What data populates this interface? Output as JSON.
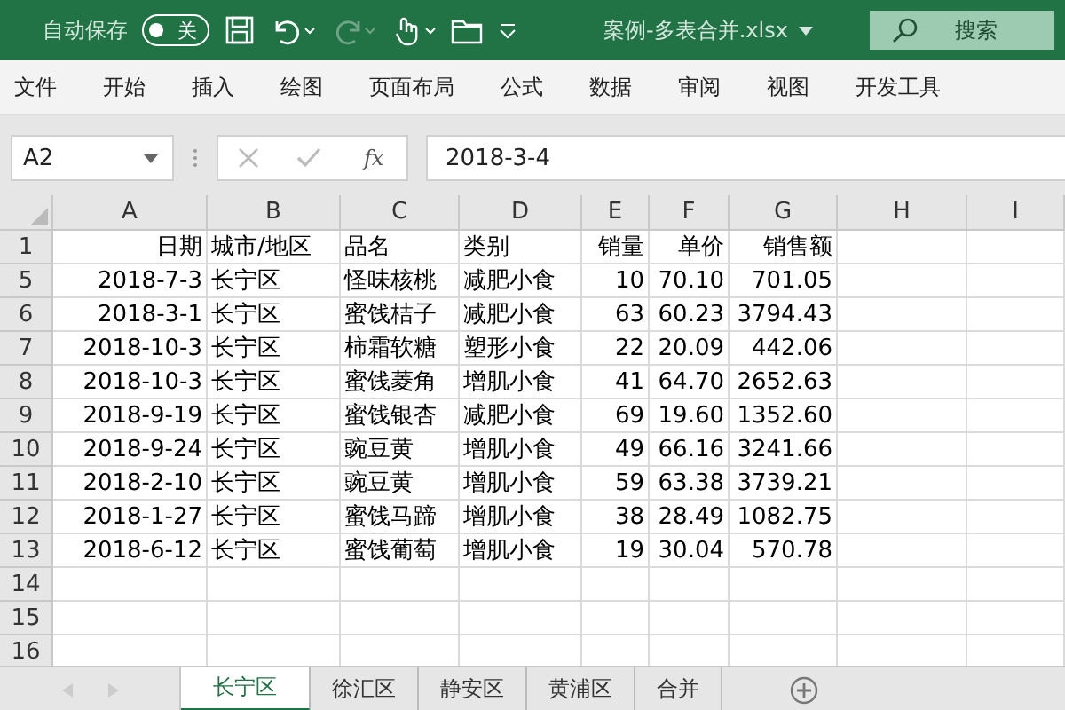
{
  "title_bar": {
    "autosave_label": "自动保存",
    "autosave": {
      "on": false,
      "state_label": "关"
    },
    "redo_disabled": true,
    "filename": "案例-多表合并.xlsx",
    "search_placeholder": "搜索"
  },
  "ribbon_tabs": [
    {
      "label": "文件",
      "selected": false
    },
    {
      "label": "开始",
      "selected": false
    },
    {
      "label": "插入",
      "selected": false
    },
    {
      "label": "绘图",
      "selected": false
    },
    {
      "label": "页面布局",
      "selected": false
    },
    {
      "label": "公式",
      "selected": false
    },
    {
      "label": "数据",
      "selected": false
    },
    {
      "label": "审阅",
      "selected": false
    },
    {
      "label": "视图",
      "selected": false
    },
    {
      "label": "开发工具",
      "selected": false
    }
  ],
  "formula_bar": {
    "name_box": "A2",
    "fx": "fx",
    "value": "2018-3-4"
  },
  "sheet": {
    "columns": [
      "A",
      "B",
      "C",
      "D",
      "E",
      "F",
      "G",
      "H",
      "I"
    ],
    "rows": [
      {
        "number": "1",
        "cells": [
          "日期",
          "城市/地区",
          "品名",
          "类别",
          "销量",
          "单价",
          "销售额"
        ]
      },
      {
        "number": "5",
        "cells": [
          "2018-7-3",
          "长宁区",
          "怪味核桃",
          "减肥小食",
          "10",
          "70.10",
          "701.05"
        ]
      },
      {
        "number": "6",
        "cells": [
          "2018-3-1",
          "长宁区",
          "蜜饯桔子",
          "减肥小食",
          "63",
          "60.23",
          "3794.43"
        ]
      },
      {
        "number": "7",
        "cells": [
          "2018-10-3",
          "长宁区",
          "柿霜软糖",
          "塑形小食",
          "22",
          "20.09",
          "442.06"
        ]
      },
      {
        "number": "8",
        "cells": [
          "2018-10-3",
          "长宁区",
          "蜜饯菱角",
          "增肌小食",
          "41",
          "64.70",
          "2652.63"
        ]
      },
      {
        "number": "9",
        "cells": [
          "2018-9-19",
          "长宁区",
          "蜜饯银杏",
          "减肥小食",
          "69",
          "19.60",
          "1352.60"
        ]
      },
      {
        "number": "10",
        "cells": [
          "2018-9-24",
          "长宁区",
          "豌豆黄",
          "增肌小食",
          "49",
          "66.16",
          "3241.66"
        ]
      },
      {
        "number": "11",
        "cells": [
          "2018-2-10",
          "长宁区",
          "豌豆黄",
          "增肌小食",
          "59",
          "63.38",
          "3739.21"
        ]
      },
      {
        "number": "12",
        "cells": [
          "2018-1-27",
          "长宁区",
          "蜜饯马蹄",
          "增肌小食",
          "38",
          "28.49",
          "1082.75"
        ]
      },
      {
        "number": "13",
        "cells": [
          "2018-6-12",
          "长宁区",
          "蜜饯葡萄",
          "增肌小食",
          "19",
          "30.04",
          "570.78"
        ]
      },
      {
        "number": "14",
        "cells": []
      },
      {
        "number": "15",
        "cells": []
      },
      {
        "number": "16",
        "cells": []
      }
    ]
  },
  "sheet_tabs": [
    {
      "label": "长宁区",
      "selected": true
    },
    {
      "label": "徐汇区",
      "selected": false
    },
    {
      "label": "静安区",
      "selected": false
    },
    {
      "label": "黄浦区",
      "selected": false
    },
    {
      "label": "合并",
      "selected": false
    }
  ]
}
